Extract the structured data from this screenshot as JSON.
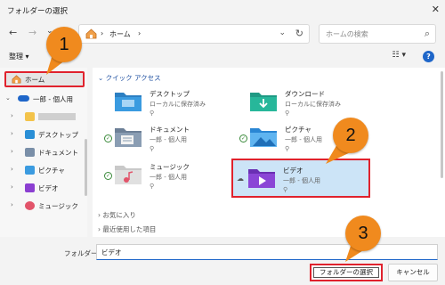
{
  "window": {
    "title": "フォルダーの選択",
    "close_glyph": "✕"
  },
  "nav": {
    "back": "←",
    "forward": "→",
    "dropdown": "⌄",
    "up": "↑"
  },
  "address": {
    "sep1": "›",
    "crumb": "ホーム",
    "sep2": "›",
    "dropdown": "⌄",
    "refresh": "↻"
  },
  "search": {
    "placeholder": "ホームの検索",
    "icon": "⌕"
  },
  "command": {
    "organize": "整理 ▾",
    "view": "☷ ▾",
    "help": "?"
  },
  "sidebar": {
    "items": [
      {
        "label": "ホーム",
        "expander": ""
      },
      {
        "label": "一郎 - 個人用",
        "expander": "⌄"
      },
      {
        "label": "",
        "expander": "›"
      },
      {
        "label": "デスクトップ",
        "expander": "›"
      },
      {
        "label": "ドキュメント",
        "expander": "›"
      },
      {
        "label": "ピクチャ",
        "expander": "›"
      },
      {
        "label": "ビデオ",
        "expander": "›"
      },
      {
        "label": "ミュージック",
        "expander": "›"
      }
    ]
  },
  "main": {
    "section_title": "⌄ クイック アクセス",
    "tiles": [
      {
        "name": "デスクトップ",
        "sub": "ローカルに保存済み",
        "pin": "⚲"
      },
      {
        "name": "ダウンロード",
        "sub": "ローカルに保存済み",
        "pin": "⚲"
      },
      {
        "name": "ドキュメント",
        "sub": "一郎 - 個人用",
        "pin": "⚲"
      },
      {
        "name": "ピクチャ",
        "sub": "一郎 - 個人用",
        "pin": "⚲"
      },
      {
        "name": "ミュージック",
        "sub": "一郎 - 個人用",
        "pin": "⚲"
      },
      {
        "name": "ビデオ",
        "sub": "一郎 - 個人用",
        "pin": "⚲"
      }
    ],
    "favorites": "› お気に入り",
    "recent": "› 最近使用した項目"
  },
  "bottom": {
    "folder_label": "フォルダー:",
    "folder_value": "ビデオ",
    "select_button": "フォルダーの選択",
    "cancel_button": "キャンセル"
  },
  "callouts": [
    "1",
    "2",
    "3"
  ],
  "colors": {
    "highlight_red": "#e0222d",
    "callout_orange": "#f08a1e",
    "selected_bg": "#cce4f7",
    "accent_blue": "#1e66c9"
  }
}
